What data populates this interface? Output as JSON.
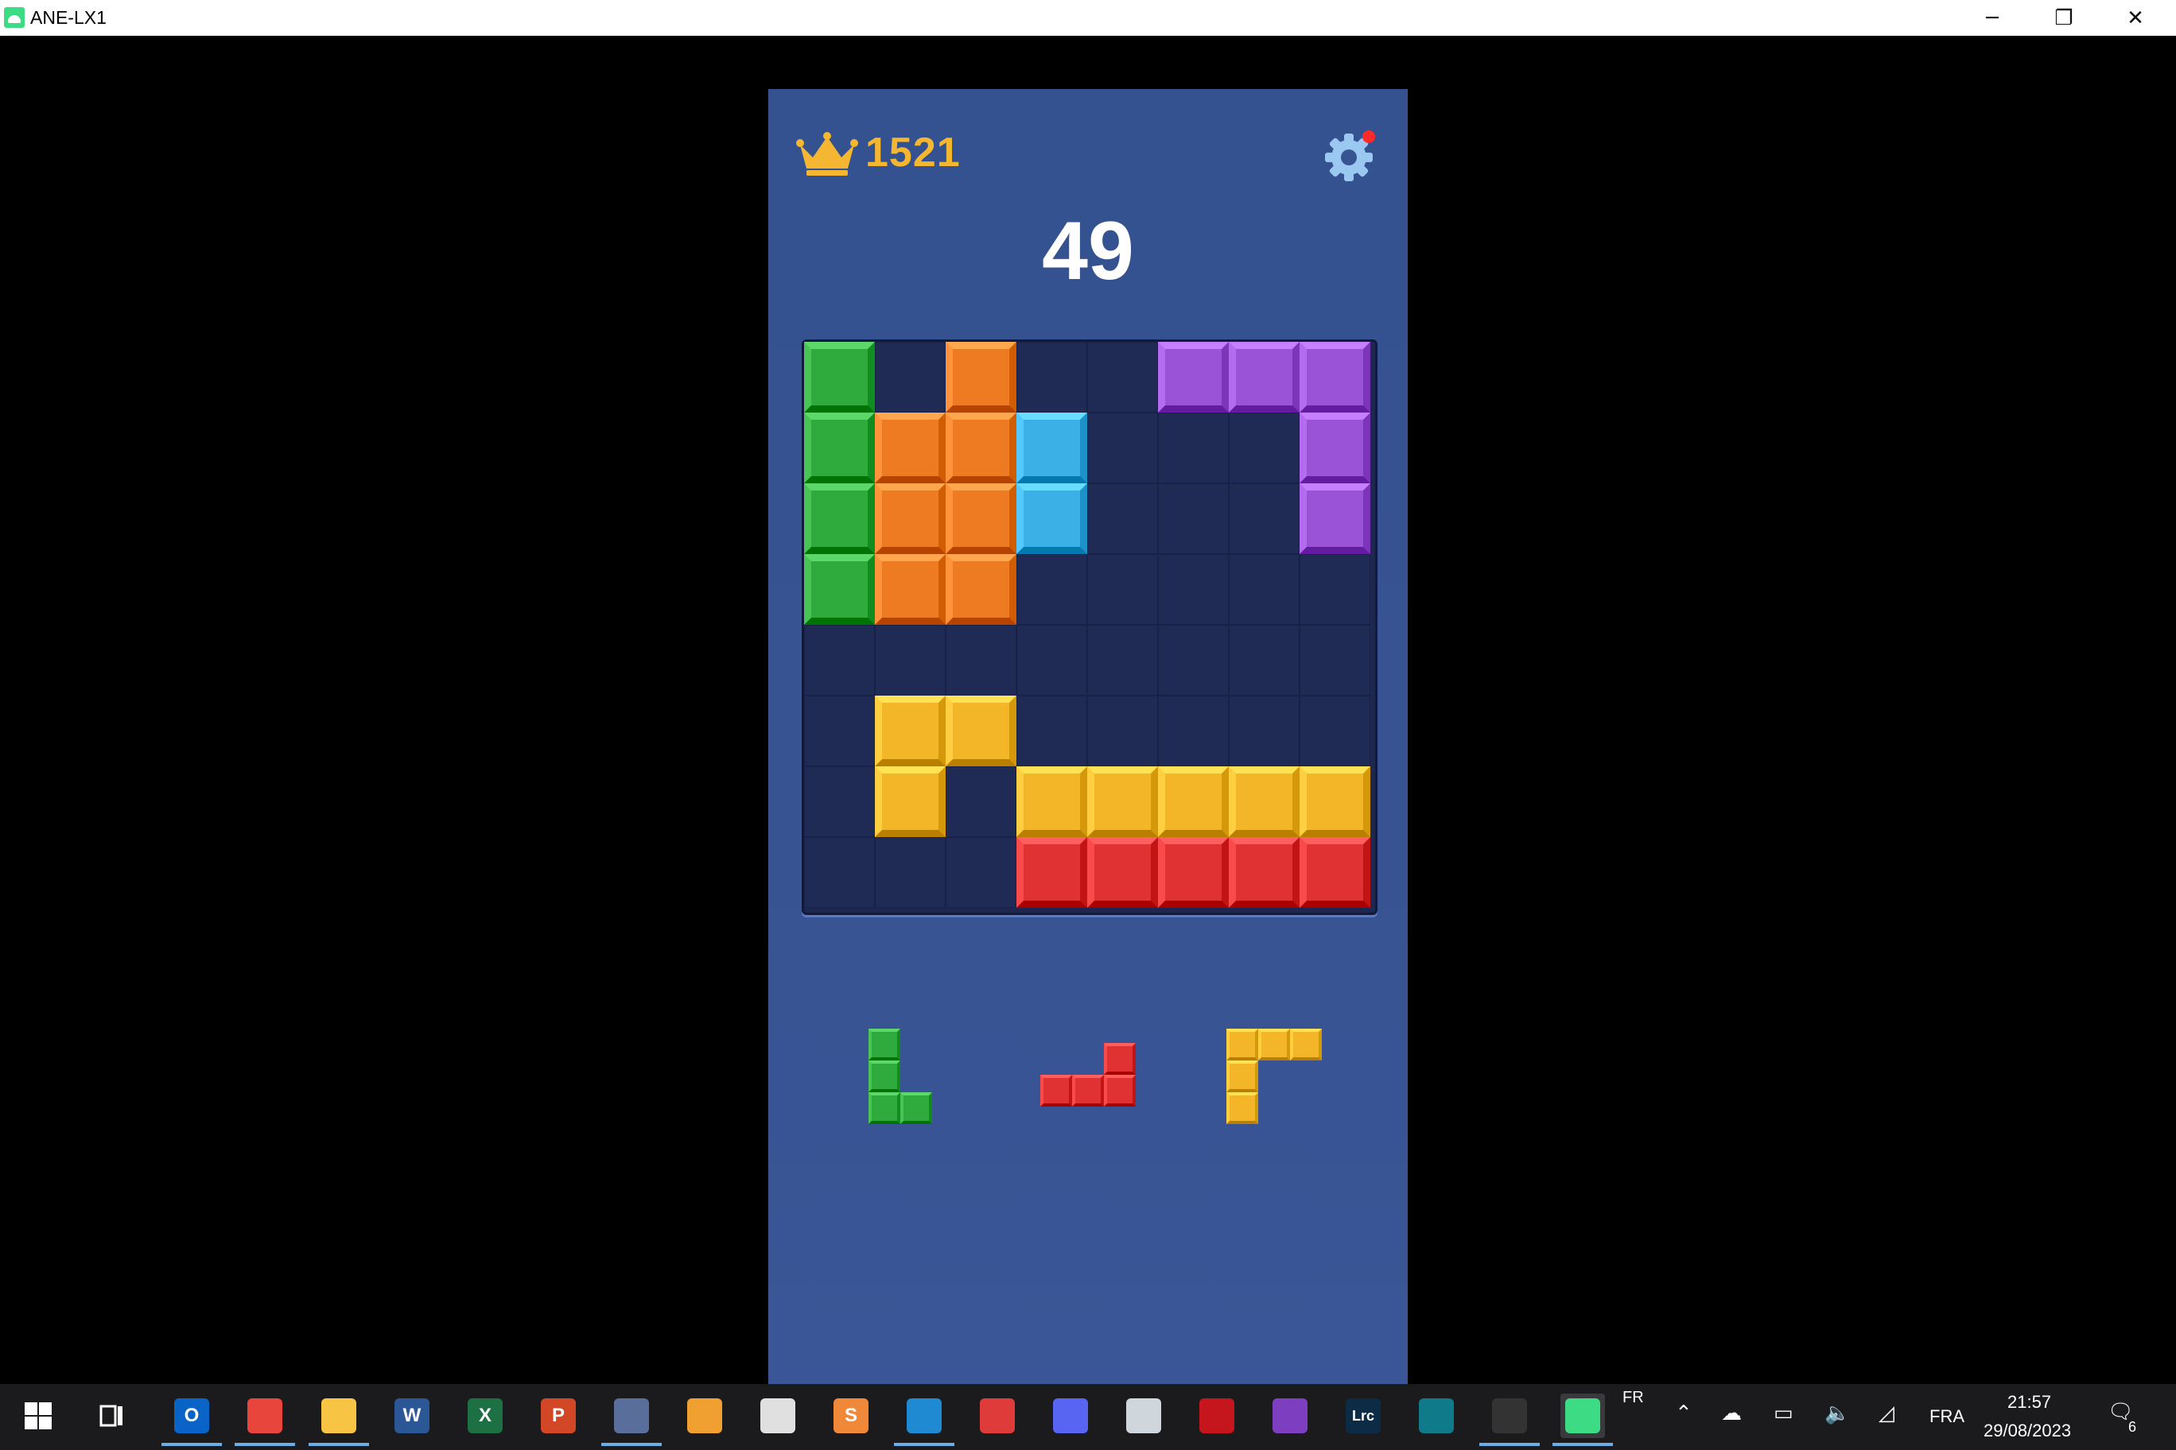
{
  "window": {
    "title": "ANE-LX1",
    "minimize_glyph": "─",
    "maximize_glyph": "❐",
    "close_glyph": "✕"
  },
  "game": {
    "best_score": "1521",
    "current_score": "49",
    "settings_has_notification": true,
    "board": {
      "size": 8,
      "rows": [
        [
          "green",
          "empty",
          "orange",
          "empty",
          "empty",
          "purple",
          "purple",
          "purple"
        ],
        [
          "green",
          "orange",
          "orange",
          "blue",
          "empty",
          "empty",
          "empty",
          "purple"
        ],
        [
          "green",
          "orange",
          "orange",
          "blue",
          "empty",
          "empty",
          "empty",
          "purple"
        ],
        [
          "green",
          "orange",
          "orange",
          "empty",
          "empty",
          "empty",
          "empty",
          "empty"
        ],
        [
          "empty",
          "empty",
          "empty",
          "empty",
          "empty",
          "empty",
          "empty",
          "empty"
        ],
        [
          "empty",
          "yellow",
          "yellow",
          "empty",
          "empty",
          "empty",
          "empty",
          "empty"
        ],
        [
          "empty",
          "yellow",
          "empty",
          "yellow",
          "yellow",
          "yellow",
          "yellow",
          "yellow"
        ],
        [
          "empty",
          "empty",
          "empty",
          "red",
          "red",
          "red",
          "red",
          "red"
        ]
      ]
    },
    "tray_pieces": [
      {
        "name": "L-piece",
        "color": "green",
        "cells": [
          [
            0,
            0
          ],
          [
            1,
            0
          ],
          [
            2,
            0
          ],
          [
            2,
            1
          ]
        ]
      },
      {
        "name": "J-piece",
        "color": "red",
        "cells": [
          [
            0,
            2
          ],
          [
            1,
            0
          ],
          [
            1,
            1
          ],
          [
            1,
            2
          ]
        ]
      },
      {
        "name": "corner-piece",
        "color": "yellow",
        "cells": [
          [
            0,
            0
          ],
          [
            0,
            1
          ],
          [
            0,
            2
          ],
          [
            1,
            0
          ],
          [
            2,
            0
          ]
        ]
      }
    ],
    "colors": {
      "green": "#2faa3c",
      "orange": "#ee7a22",
      "blue": "#3bb0e6",
      "purple": "#9a52d6",
      "yellow": "#f2b628",
      "red": "#e03232",
      "crown": "#f5b731",
      "gear": "#9bc8f0",
      "notification": "#ff2a2a"
    }
  },
  "taskbar": {
    "apps": [
      {
        "name": "start-button",
        "icon": "windows-icon",
        "color": "#ffffff"
      },
      {
        "name": "task-view-button",
        "icon": "task-view-icon",
        "color": "#ffffff"
      },
      {
        "name": "outlook-app",
        "icon": "outlook-icon",
        "color": "#0a64c8",
        "label": "O"
      },
      {
        "name": "chrome-app",
        "icon": "chrome-icon",
        "color": "#e8453c"
      },
      {
        "name": "explorer-app",
        "icon": "folder-icon",
        "color": "#f7c443"
      },
      {
        "name": "word-app",
        "icon": "word-icon",
        "color": "#2b5797",
        "label": "W"
      },
      {
        "name": "excel-app",
        "icon": "excel-icon",
        "color": "#1d7044",
        "label": "X"
      },
      {
        "name": "powerpoint-app",
        "icon": "powerpoint-icon",
        "color": "#d24726",
        "label": "P"
      },
      {
        "name": "paint-app",
        "icon": "paint-icon",
        "color": "#5a6e9c"
      },
      {
        "name": "media-app",
        "icon": "media-icon",
        "color": "#f0a030"
      },
      {
        "name": "python-app",
        "icon": "python-icon",
        "color": "#e0e0e0"
      },
      {
        "name": "sublime-app",
        "icon": "sublime-icon",
        "color": "#f0883a",
        "label": "S"
      },
      {
        "name": "vscode-app",
        "icon": "vscode-icon",
        "color": "#1f8ad2"
      },
      {
        "name": "snipping-app",
        "icon": "scissors-icon",
        "color": "#e03b3b"
      },
      {
        "name": "discord-app",
        "icon": "discord-icon",
        "color": "#5865f2"
      },
      {
        "name": "backup-app",
        "icon": "drive-icon",
        "color": "#cfd6dc"
      },
      {
        "name": "acrobat-app",
        "icon": "acrobat-icon",
        "color": "#c4161c"
      },
      {
        "name": "github-app",
        "icon": "github-icon",
        "color": "#7d3fc0"
      },
      {
        "name": "lightroom-app",
        "icon": "lightroom-icon",
        "color": "#0b2c44",
        "label": "Lrc"
      },
      {
        "name": "panel-app",
        "icon": "panel-icon",
        "color": "#0e7a8a"
      },
      {
        "name": "obs-app",
        "icon": "obs-icon",
        "color": "#333333"
      },
      {
        "name": "android-app",
        "icon": "android-icon",
        "color": "#3ddc84"
      }
    ],
    "tray": {
      "lang_small": "FR",
      "lang": "FRA",
      "time": "21:57",
      "date": "29/08/2023",
      "notification_count": "6"
    }
  }
}
